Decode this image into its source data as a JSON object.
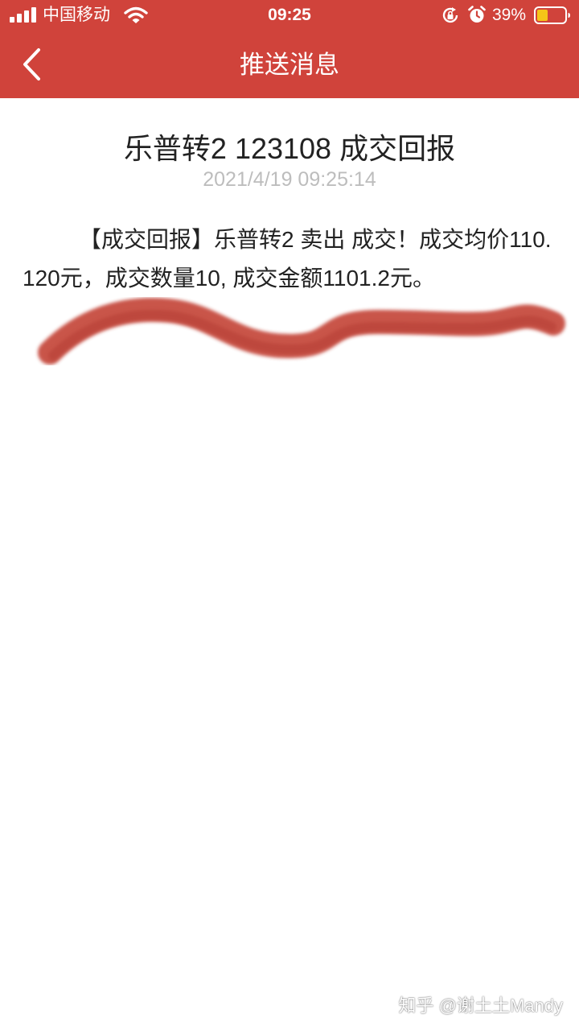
{
  "status_bar": {
    "carrier": "中国移动",
    "time": "09:25",
    "battery_percent": "39%",
    "icons": [
      "signal-icon",
      "wifi-icon",
      "rotation-lock-icon",
      "alarm-icon",
      "battery-icon"
    ]
  },
  "nav": {
    "title": "推送消息",
    "back_icon": "chevron-left-icon"
  },
  "message": {
    "title": "乐普转2 123108 成交回报",
    "timestamp": "2021/4/19 09:25:14",
    "body": "【成交回报】乐普转2 卖出 成交！成交均价110.120元，成交数量10, 成交金额1101.2元。"
  },
  "watermark": {
    "text": "知乎 @谢土土Mandy"
  },
  "colors": {
    "header_red": "#d0433b",
    "scribble_red": "#c0392b",
    "timestamp_gray": "#bdbdbd",
    "text_dark": "#222222"
  }
}
